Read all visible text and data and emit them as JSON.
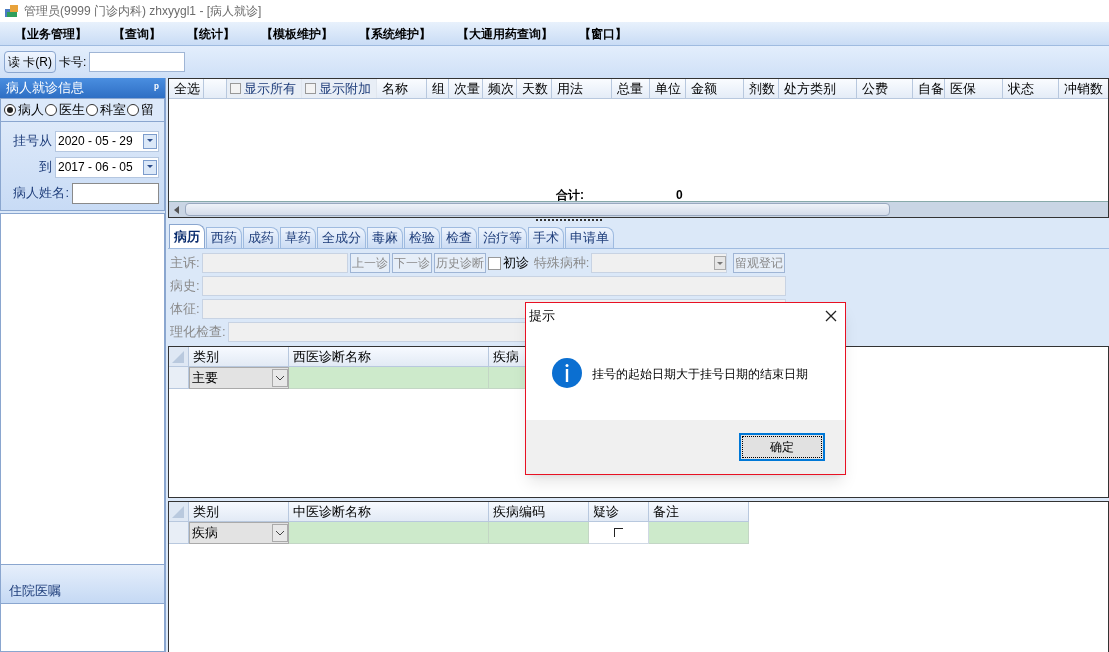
{
  "window": {
    "title": "管理员(9999 门诊内科) zhxyygl1 - [病人就诊]"
  },
  "menu": [
    "【业务管理】",
    "【查询】",
    "【统计】",
    "【模板维护】",
    "【系统维护】",
    "【大通用药查询】",
    "【窗口】"
  ],
  "toolbar": {
    "read_card_button": "读 卡(R)",
    "card_label": "卡号:"
  },
  "left_panel": {
    "title": "病人就诊信息",
    "pin": "ᵖ",
    "radios": [
      {
        "label": "病人",
        "selected": true
      },
      {
        "label": "医生",
        "selected": false
      },
      {
        "label": "科室",
        "selected": false
      },
      {
        "label": "留",
        "selected": false
      }
    ],
    "from_label": "挂号从",
    "from_date": "2020 - 05 - 29",
    "to_label": "到",
    "to_date": "2017 - 06 - 05",
    "name_label": "病人姓名:",
    "bottom_title": "住院医嘱"
  },
  "grid": {
    "columns": [
      {
        "kind": "text",
        "label": "全选"
      },
      {
        "kind": "blank"
      },
      {
        "kind": "checkbox",
        "label": "显示所有",
        "checked": false
      },
      {
        "kind": "checkbox",
        "label": "显示附加",
        "checked": false
      },
      {
        "kind": "text",
        "label": "名称"
      },
      {
        "kind": "text",
        "label": "组"
      },
      {
        "kind": "text",
        "label": "次量"
      },
      {
        "kind": "text",
        "label": "频次"
      },
      {
        "kind": "text",
        "label": "天数"
      },
      {
        "kind": "text",
        "label": "用法"
      },
      {
        "kind": "text",
        "label": "总量"
      },
      {
        "kind": "text",
        "label": "单位"
      },
      {
        "kind": "text",
        "label": "金额"
      },
      {
        "kind": "text",
        "label": "剂数"
      },
      {
        "kind": "text",
        "label": "处方类别"
      },
      {
        "kind": "text",
        "label": "公费"
      },
      {
        "kind": "text",
        "label": "自备"
      },
      {
        "kind": "text",
        "label": "医保"
      },
      {
        "kind": "text",
        "label": "状态"
      },
      {
        "kind": "text",
        "label": "冲销数"
      }
    ],
    "total_label": "合计:",
    "total_value": "0"
  },
  "tabs": [
    {
      "label": "病历",
      "selected": true
    },
    {
      "label": "西药",
      "selected": false
    },
    {
      "label": "成药",
      "selected": false
    },
    {
      "label": "草药",
      "selected": false
    },
    {
      "label": "全成分",
      "selected": false
    },
    {
      "label": "毒麻",
      "selected": false
    },
    {
      "label": "检验",
      "selected": false
    },
    {
      "label": "检查",
      "selected": false
    },
    {
      "label": "治疗等",
      "selected": false
    },
    {
      "label": "手术",
      "selected": false
    },
    {
      "label": "申请单",
      "selected": false
    }
  ],
  "record_form": {
    "complaint_label": "主诉:",
    "buttons": [
      "上一诊",
      "下一诊",
      "历史诊断"
    ],
    "first_visit": {
      "label": "初诊",
      "checked": false
    },
    "special_label": "特殊病种:",
    "observe_button": "留观登记",
    "history_label": "病史:",
    "signs_label": "体征:",
    "lab_label": "理化检查:"
  },
  "western_diagnosis": {
    "columns": [
      "类别",
      "西医诊断名称",
      "疾病"
    ],
    "rows": [
      {
        "category": "主要"
      }
    ]
  },
  "chinese_diagnosis": {
    "columns": [
      "类别",
      "中医诊断名称",
      "疾病编码",
      "疑诊",
      "备注"
    ],
    "rows": [
      {
        "category": "疾病",
        "suspected": false
      }
    ]
  },
  "dialog": {
    "title": "提示",
    "message": "挂号的起始日期大于挂号日期的结束日期",
    "ok_button": "确定"
  }
}
